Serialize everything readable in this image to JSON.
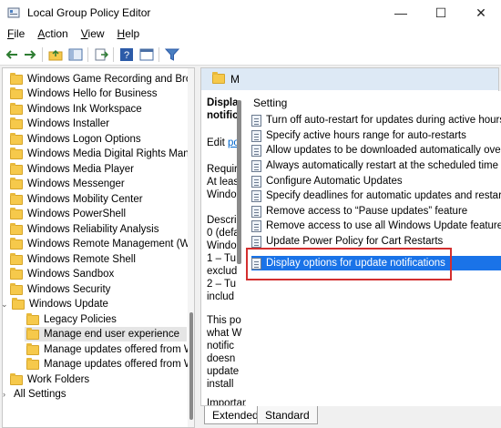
{
  "window": {
    "title": "Local Group Policy Editor",
    "controls": [
      "—",
      "☐",
      "✕"
    ]
  },
  "menu": [
    {
      "key": "F",
      "rest": "ile"
    },
    {
      "key": "A",
      "rest": "ction"
    },
    {
      "key": "V",
      "rest": "iew"
    },
    {
      "key": "H",
      "rest": "elp"
    }
  ],
  "tree": {
    "items": [
      {
        "label": "Windows Game Recording and Bro"
      },
      {
        "label": "Windows Hello for Business"
      },
      {
        "label": "Windows Ink Workspace"
      },
      {
        "label": "Windows Installer"
      },
      {
        "label": "Windows Logon Options"
      },
      {
        "label": "Windows Media Digital Rights Man"
      },
      {
        "label": "Windows Media Player"
      },
      {
        "label": "Windows Messenger"
      },
      {
        "label": "Windows Mobility Center"
      },
      {
        "label": "Windows PowerShell"
      },
      {
        "label": "Windows Reliability Analysis"
      },
      {
        "label": "Windows Remote Management (W"
      },
      {
        "label": "Windows Remote Shell"
      },
      {
        "label": "Windows Sandbox"
      },
      {
        "label": "Windows Security"
      },
      {
        "label": "Windows Update"
      },
      {
        "label": "Legacy Policies"
      },
      {
        "label": "Manage end user experience"
      },
      {
        "label": "Manage updates offered from W"
      },
      {
        "label": "Manage updates offered from W"
      },
      {
        "label": "Work Folders"
      },
      {
        "label": "All Settings"
      }
    ]
  },
  "description": {
    "header": "M",
    "title_line1": "Displa",
    "title_line2": "notific",
    "edit_prefix": "Edit",
    "edit_link": "po",
    "lines": [
      "Requir",
      "At leas",
      "Windo",
      "Descri",
      "0 (defa",
      "Windo",
      "1 – Tu",
      "exclud",
      "2 – Tu",
      "includ",
      "This po",
      "what W",
      "notific",
      "doesn",
      "update",
      "install",
      "Importantly if you choose not to"
    ]
  },
  "settings": {
    "header": "Setting",
    "items": [
      {
        "label": "Turn off auto-restart for updates during active hours"
      },
      {
        "label": "Specify active hours range for auto-restarts"
      },
      {
        "label": "Allow updates to be downloaded automatically over"
      },
      {
        "label": "Always automatically restart at the scheduled time"
      },
      {
        "label": "Configure Automatic Updates"
      },
      {
        "label": "Specify deadlines for automatic updates and restarts"
      },
      {
        "label": "Remove access to “Pause updates” feature"
      },
      {
        "label": "Remove access to use all Windows Update features"
      },
      {
        "label": "Update Power Policy for Cart Restarts"
      },
      {
        "label": "Display options for update notifications"
      }
    ]
  },
  "tabs": [
    {
      "label": "Extended"
    },
    {
      "label": "Standard"
    }
  ],
  "colors": {
    "selection": "#1a73e8",
    "highlight_box": "#d32f2f",
    "folder": "#f6c94b"
  }
}
